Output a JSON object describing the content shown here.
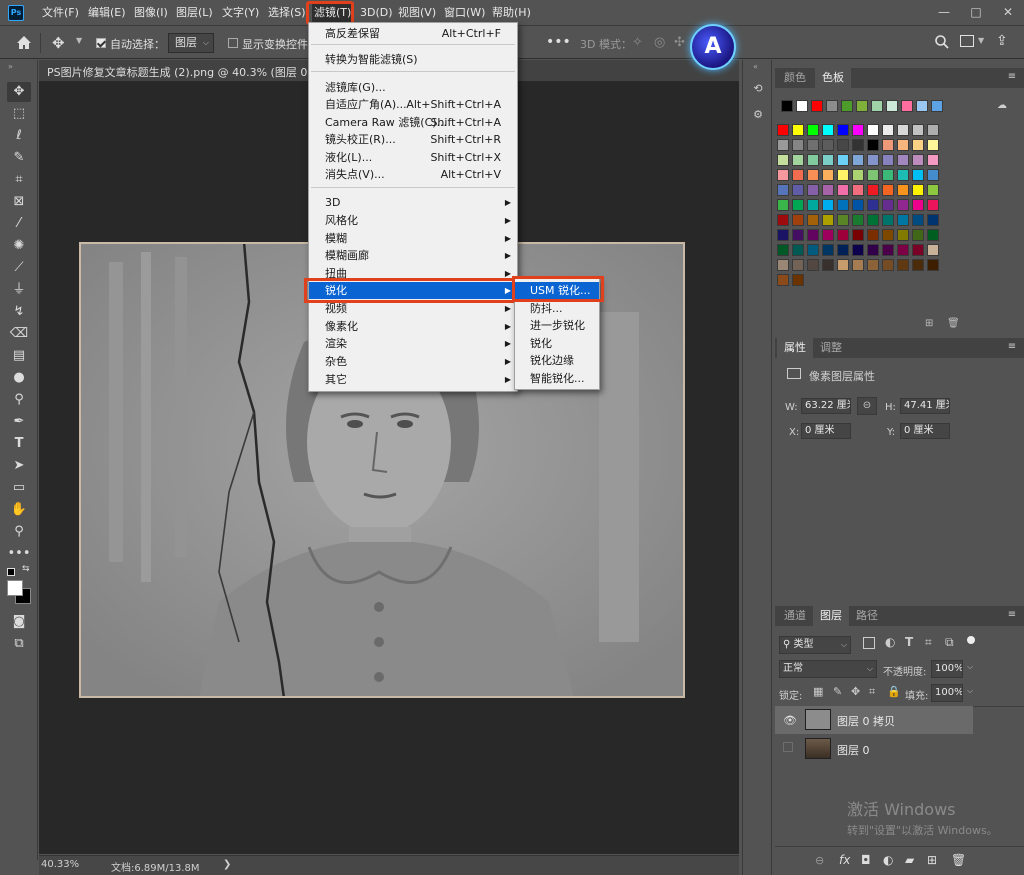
{
  "menubar": {
    "app_icon": "Ps",
    "items": [
      "文件(F)",
      "编辑(E)",
      "图像(I)",
      "图层(L)",
      "文字(Y)",
      "选择(S)",
      "滤镜(T)",
      "3D(D)",
      "视图(V)",
      "窗口(W)",
      "帮助(H)"
    ],
    "window_controls": [
      "—",
      "□",
      "✕"
    ]
  },
  "options_bar": {
    "auto_select_label": "自动选择：",
    "auto_select_value": "图层",
    "show_transform_label": "显示变换控件",
    "mode_3d_label": "3D 模式："
  },
  "document": {
    "tab_title": "PS图片修复文章标题生成 (2).png @ 40.3% (图层 0 拷贝,",
    "zoom": "40.33%",
    "doc_size": "文档:6.89M/13.8M",
    "status_arrow": "❯"
  },
  "filter_menu": {
    "items": [
      {
        "label": "高反差保留",
        "shortcut": "Alt+Ctrl+F"
      },
      {
        "sep": true
      },
      {
        "label": "转换为智能滤镜(S)",
        "shortcut": ""
      },
      {
        "sep": true
      },
      {
        "label": "滤镜库(G)...",
        "shortcut": ""
      },
      {
        "label": "自适应广角(A)...",
        "shortcut": "Alt+Shift+Ctrl+A"
      },
      {
        "label": "Camera Raw 滤镜(C)...",
        "shortcut": "Shift+Ctrl+A"
      },
      {
        "label": "镜头校正(R)...",
        "shortcut": "Shift+Ctrl+R"
      },
      {
        "label": "液化(L)...",
        "shortcut": "Shift+Ctrl+X"
      },
      {
        "label": "消失点(V)...",
        "shortcut": "Alt+Ctrl+V"
      },
      {
        "sep": true
      },
      {
        "label": "3D",
        "submenu": true
      },
      {
        "label": "风格化",
        "submenu": true
      },
      {
        "label": "模糊",
        "submenu": true
      },
      {
        "label": "模糊画廊",
        "submenu": true
      },
      {
        "label": "扭曲",
        "submenu": true
      },
      {
        "label": "锐化",
        "submenu": true,
        "hover": true
      },
      {
        "label": "视频",
        "submenu": true
      },
      {
        "label": "像素化",
        "submenu": true
      },
      {
        "label": "渲染",
        "submenu": true
      },
      {
        "label": "杂色",
        "submenu": true
      },
      {
        "label": "其它",
        "submenu": true
      }
    ]
  },
  "sharpen_submenu": {
    "items": [
      {
        "label": "USM 锐化...",
        "hover": true
      },
      {
        "label": "防抖..."
      },
      {
        "label": "进一步锐化"
      },
      {
        "label": "锐化"
      },
      {
        "label": "锐化边缘"
      },
      {
        "label": "智能锐化..."
      }
    ]
  },
  "swatches_panel": {
    "tabs": [
      "颜色",
      "色板"
    ],
    "active_tab": "色板",
    "recent": [
      "#000000",
      "#ffffff",
      "#ff0000",
      "#8c8c8c",
      "#4c9b2b",
      "#7fb03a",
      "#9fd2a7",
      "#cce8d8",
      "#ff6e9e",
      "#9ac6ef",
      "#5ea2e6"
    ],
    "grid": [
      [
        "#ff0000",
        "#ffff00",
        "#00ff00",
        "#00ffff",
        "#0000ff",
        "#ff00ff",
        "#ffffff",
        "#ebebeb",
        "#d7d7d7",
        "#c2c2c2",
        "#adadad"
      ],
      [
        "#999999",
        "#858585",
        "#707070",
        "#5c5c5c",
        "#474747",
        "#333333",
        "#000000",
        "#ee9a78",
        "#f7b47d",
        "#fbd283",
        "#fff699"
      ],
      [
        "#c4df9b",
        "#a2d39c",
        "#81ca9d",
        "#7bcdc8",
        "#6ccff6",
        "#7ea7d8",
        "#8493ca",
        "#8882be",
        "#a187be",
        "#bc8cbf",
        "#f49ac2"
      ],
      [
        "#f6989d",
        "#f26c4f",
        "#f68e55",
        "#fbaf5c",
        "#fff467",
        "#acd372",
        "#7dc473",
        "#3cb878",
        "#1cbbb4",
        "#00bff3",
        "#448ccb"
      ],
      [
        "#5574b9",
        "#605ca8",
        "#855fa8",
        "#a763a8",
        "#f06ea9",
        "#f26d7d",
        "#ed1c24",
        "#f26522",
        "#f7941d",
        "#fff200",
        "#8dc63f"
      ],
      [
        "#39b54a",
        "#00a651",
        "#00a99d",
        "#00aeef",
        "#0072bc",
        "#0054a6",
        "#2e3192",
        "#662d91",
        "#92278f",
        "#ec008c",
        "#ed145b"
      ],
      [
        "#9e0b0f",
        "#a0410d",
        "#a36209",
        "#aba000",
        "#598527",
        "#1a7b30",
        "#007236",
        "#00746b",
        "#0076a3",
        "#004b80",
        "#003471"
      ],
      [
        "#1b1464",
        "#440e62",
        "#630460",
        "#9e005d",
        "#9e0039",
        "#790000",
        "#7b2e00",
        "#7d4900",
        "#827b00",
        "#406618",
        "#005e20"
      ],
      [
        "#005826",
        "#005952",
        "#005b7f",
        "#003663",
        "#002157",
        "#0d004c",
        "#32004b",
        "#4b0049",
        "#7b0046",
        "#7a0026",
        "#c7b299"
      ],
      [
        "#998675",
        "#736357",
        "#534741",
        "#37302d",
        "#c69c6d",
        "#a67c52",
        "#8c6239",
        "#754c24",
        "#603913",
        "#4a2c0a",
        "#3d1f00"
      ],
      [
        "#8c4a1a",
        "#6b3300"
      ]
    ]
  },
  "properties_panel": {
    "tabs": [
      "属性",
      "调整"
    ],
    "active_tab": "属性",
    "section_title": "像素图层属性",
    "w_label": "W:",
    "w_value": "63.22 厘米",
    "h_label": "H:",
    "h_value": "47.41 厘米",
    "x_label": "X:",
    "x_value": "0 厘米",
    "y_label": "Y:",
    "y_value": "0 厘米"
  },
  "layers_panel": {
    "tabs": [
      "通道",
      "图层",
      "路径"
    ],
    "active_tab": "图层",
    "filter_label": "类型",
    "blend_mode": "正常",
    "opacity_label": "不透明度:",
    "opacity_value": "100%",
    "lock_label": "锁定:",
    "fill_label": "填充:",
    "fill_value": "100%",
    "layers": [
      {
        "name": "图层 0 拷贝",
        "visible": true,
        "selected": true
      },
      {
        "name": "图层 0",
        "visible": false,
        "selected": false
      }
    ]
  },
  "activation": {
    "line1": "激活 Windows",
    "line2": "转到\"设置\"以激活 Windows。"
  },
  "badge": {
    "letter": "A"
  }
}
